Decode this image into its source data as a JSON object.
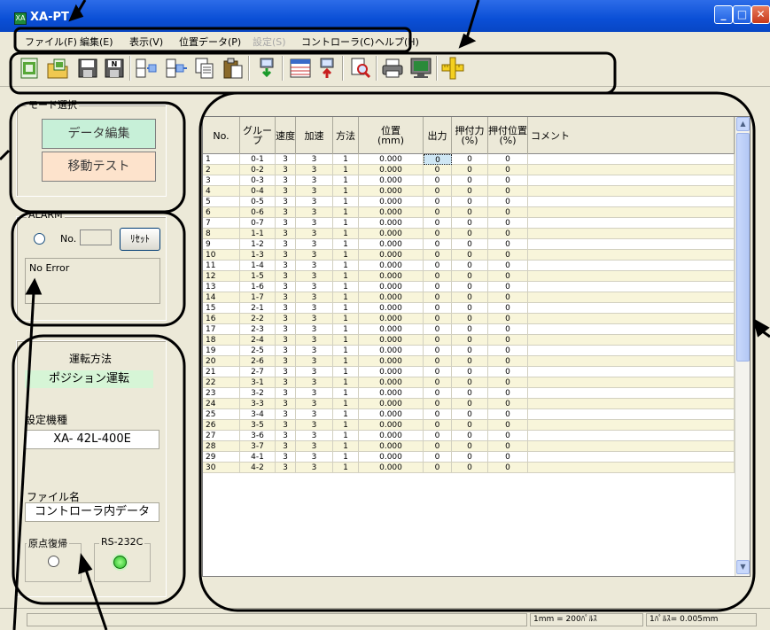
{
  "window": {
    "title": "XA-PT",
    "icon": "app-icon",
    "controls": [
      "minimize-icon",
      "maximize-icon",
      "close-icon"
    ]
  },
  "menu": [
    {
      "label": "ファイル(F)",
      "enabled": true
    },
    {
      "label": "編集(E)",
      "enabled": true
    },
    {
      "label": "表示(V)",
      "enabled": true
    },
    {
      "label": "位置データ(P)",
      "enabled": true
    },
    {
      "label": "設定(S)",
      "enabled": false
    },
    {
      "label": "コントローラ(C)",
      "enabled": true
    },
    {
      "label": "ヘルプ(H)",
      "enabled": true
    }
  ],
  "toolbar": {
    "buttons": [
      "open-file-icon",
      "open-folder-icon",
      "save-icon",
      "save-as-icon",
      "insert-row-icon",
      "append-row-icon",
      "copy-icon",
      "paste-icon",
      "download-icon",
      "table-icon",
      "upload-icon",
      "search-icon",
      "print-icon",
      "monitor-icon",
      "ruler-icon"
    ]
  },
  "mode_panel": {
    "label": "モード選択",
    "edit_button": "データ編集",
    "move_button": "移動テスト"
  },
  "alarm_panel": {
    "label": "ALARM",
    "no_label": "No.",
    "no_value": "",
    "reset_button": "ﾘｾｯﾄ",
    "error_text": "No Error"
  },
  "info_panel": {
    "drive_label": "運転方法",
    "drive_value": "ポジション運転",
    "model_label": "設定機種",
    "model_value": "XA- 42L-400E",
    "file_label": "ファイル名",
    "file_value": "コントローラ内データ",
    "origin_label": "原点復帰",
    "rs_label": "RS-232C"
  },
  "grid": {
    "columns": [
      "No.",
      "グループ",
      "速度",
      "加速",
      "方法",
      "位置\n(mm)",
      "出力",
      "押付力\n(%)",
      "押付位置\n(%)",
      "コメント"
    ],
    "rows": [
      [
        "1",
        "0-1",
        "3",
        "3",
        "1",
        "0.000",
        "0",
        "0",
        "0",
        ""
      ],
      [
        "2",
        "0-2",
        "3",
        "3",
        "1",
        "0.000",
        "0",
        "0",
        "0",
        ""
      ],
      [
        "3",
        "0-3",
        "3",
        "3",
        "1",
        "0.000",
        "0",
        "0",
        "0",
        ""
      ],
      [
        "4",
        "0-4",
        "3",
        "3",
        "1",
        "0.000",
        "0",
        "0",
        "0",
        ""
      ],
      [
        "5",
        "0-5",
        "3",
        "3",
        "1",
        "0.000",
        "0",
        "0",
        "0",
        ""
      ],
      [
        "6",
        "0-6",
        "3",
        "3",
        "1",
        "0.000",
        "0",
        "0",
        "0",
        ""
      ],
      [
        "7",
        "0-7",
        "3",
        "3",
        "1",
        "0.000",
        "0",
        "0",
        "0",
        ""
      ],
      [
        "8",
        "1-1",
        "3",
        "3",
        "1",
        "0.000",
        "0",
        "0",
        "0",
        ""
      ],
      [
        "9",
        "1-2",
        "3",
        "3",
        "1",
        "0.000",
        "0",
        "0",
        "0",
        ""
      ],
      [
        "10",
        "1-3",
        "3",
        "3",
        "1",
        "0.000",
        "0",
        "0",
        "0",
        ""
      ],
      [
        "11",
        "1-4",
        "3",
        "3",
        "1",
        "0.000",
        "0",
        "0",
        "0",
        ""
      ],
      [
        "12",
        "1-5",
        "3",
        "3",
        "1",
        "0.000",
        "0",
        "0",
        "0",
        ""
      ],
      [
        "13",
        "1-6",
        "3",
        "3",
        "1",
        "0.000",
        "0",
        "0",
        "0",
        ""
      ],
      [
        "14",
        "1-7",
        "3",
        "3",
        "1",
        "0.000",
        "0",
        "0",
        "0",
        ""
      ],
      [
        "15",
        "2-1",
        "3",
        "3",
        "1",
        "0.000",
        "0",
        "0",
        "0",
        ""
      ],
      [
        "16",
        "2-2",
        "3",
        "3",
        "1",
        "0.000",
        "0",
        "0",
        "0",
        ""
      ],
      [
        "17",
        "2-3",
        "3",
        "3",
        "1",
        "0.000",
        "0",
        "0",
        "0",
        ""
      ],
      [
        "18",
        "2-4",
        "3",
        "3",
        "1",
        "0.000",
        "0",
        "0",
        "0",
        ""
      ],
      [
        "19",
        "2-5",
        "3",
        "3",
        "1",
        "0.000",
        "0",
        "0",
        "0",
        ""
      ],
      [
        "20",
        "2-6",
        "3",
        "3",
        "1",
        "0.000",
        "0",
        "0",
        "0",
        ""
      ],
      [
        "21",
        "2-7",
        "3",
        "3",
        "1",
        "0.000",
        "0",
        "0",
        "0",
        ""
      ],
      [
        "22",
        "3-1",
        "3",
        "3",
        "1",
        "0.000",
        "0",
        "0",
        "0",
        ""
      ],
      [
        "23",
        "3-2",
        "3",
        "3",
        "1",
        "0.000",
        "0",
        "0",
        "0",
        ""
      ],
      [
        "24",
        "3-3",
        "3",
        "3",
        "1",
        "0.000",
        "0",
        "0",
        "0",
        ""
      ],
      [
        "25",
        "3-4",
        "3",
        "3",
        "1",
        "0.000",
        "0",
        "0",
        "0",
        ""
      ],
      [
        "26",
        "3-5",
        "3",
        "3",
        "1",
        "0.000",
        "0",
        "0",
        "0",
        ""
      ],
      [
        "27",
        "3-6",
        "3",
        "3",
        "1",
        "0.000",
        "0",
        "0",
        "0",
        ""
      ],
      [
        "28",
        "3-7",
        "3",
        "3",
        "1",
        "0.000",
        "0",
        "0",
        "0",
        ""
      ],
      [
        "29",
        "4-1",
        "3",
        "3",
        "1",
        "0.000",
        "0",
        "0",
        "0",
        ""
      ],
      [
        "30",
        "4-2",
        "3",
        "3",
        "1",
        "0.000",
        "0",
        "0",
        "0",
        ""
      ]
    ],
    "selected_cell": "output-row-1"
  },
  "status": {
    "pane1": "",
    "pane2": "1mm = 200ﾊﾟﾙｽ",
    "pane3": "1ﾊﾟﾙｽ= 0.005mm"
  },
  "colors": {
    "title_bar": "#0a4fd6",
    "edit_button": "#c7f0d8",
    "move_button": "#fde3cc",
    "drive_mode": "#d6f5d6",
    "row_alt": "#f8f5da",
    "led_on": "#3ed33e"
  }
}
